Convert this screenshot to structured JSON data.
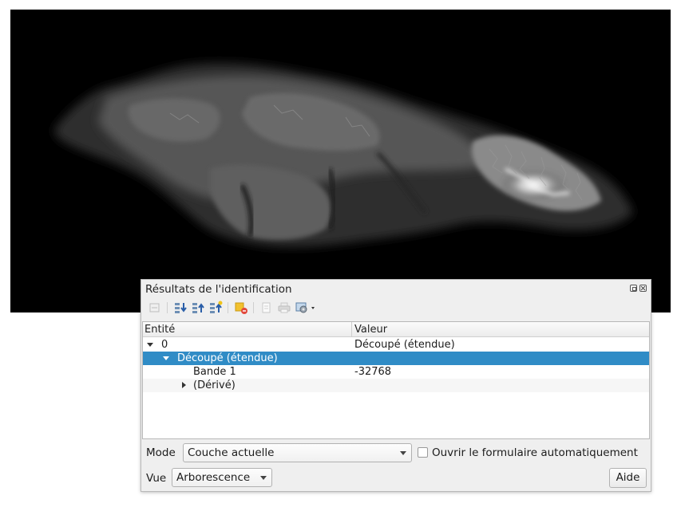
{
  "panel": {
    "title": "Résultats de l'identification"
  },
  "toolbar": {
    "icons": [
      "expand-tree-icon",
      "collapse-all-icon",
      "expand-all-icon",
      "expand-new-results-icon",
      "clear-results-icon",
      "copy-feature-icon",
      "print-icon",
      "identify-settings-icon"
    ]
  },
  "table": {
    "headers": {
      "entity": "Entité",
      "value": "Valeur"
    },
    "rows": [
      {
        "entity": "0",
        "value": "Découpé (étendue)"
      },
      {
        "entity": "Découpé (étendue)",
        "value": ""
      },
      {
        "entity": "Bande 1",
        "value": "-32768"
      },
      {
        "entity": "(Dérivé)",
        "value": ""
      }
    ]
  },
  "controls": {
    "mode_label": "Mode",
    "mode_value": "Couche actuelle",
    "auto_open_label": "Ouvrir le formulaire automatiquement",
    "auto_open_checked": false,
    "view_label": "Vue",
    "view_value": "Arborescence",
    "help_label": "Aide"
  },
  "colors": {
    "selection": "#308cc6",
    "canvas_background": "#000000"
  }
}
